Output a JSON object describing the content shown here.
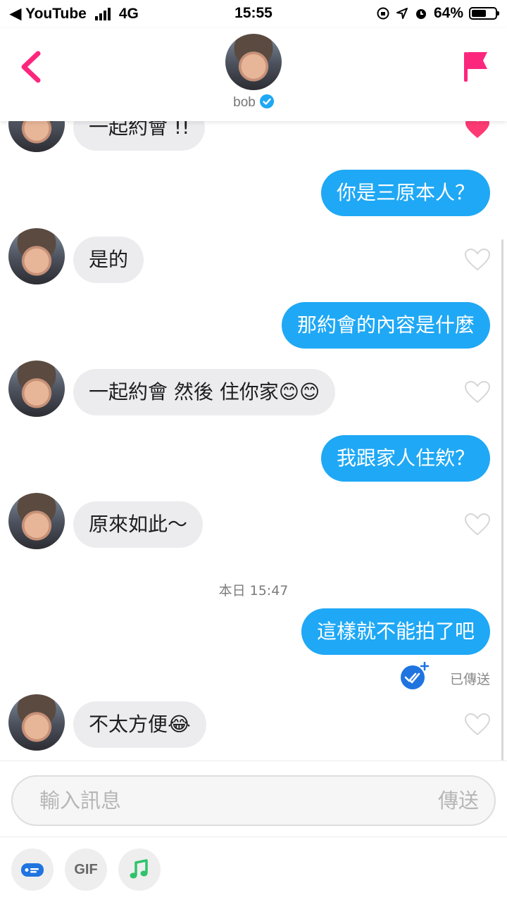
{
  "status_bar": {
    "back_app": "YouTube",
    "network": "4G",
    "time": "15:55",
    "battery": "64%",
    "battery_level": 0.64
  },
  "header": {
    "contact_name": "bob"
  },
  "messages": [
    {
      "side": "in",
      "text": "一起約會 !!"
    },
    {
      "side": "out",
      "text": "你是三原本人？"
    },
    {
      "side": "in",
      "text": "是的"
    },
    {
      "side": "out",
      "text": "那約會的內容是什麼"
    },
    {
      "side": "in",
      "text": "一起約會 然後 住你家😊😊"
    },
    {
      "side": "out",
      "text": "我跟家人住欸？"
    },
    {
      "side": "in",
      "text": "原來如此～"
    },
    {
      "side": "out",
      "text": "這樣就不能拍了吧"
    },
    {
      "side": "in",
      "text": "不太方便😂"
    }
  ],
  "timestamp": "本日 15:47",
  "sent_label": "已傳送",
  "input": {
    "placeholder": "輸入訊息",
    "send_label": "傳送"
  },
  "toolbar": {
    "gif_label": "GIF"
  },
  "colors": {
    "accent": "#fd267d",
    "bubble_out": "#1fa8f5",
    "bubble_in": "#ececef"
  },
  "icons": [
    "back-chevron-icon",
    "report-flag-icon",
    "verified-badge-icon",
    "heart-icon",
    "sent-check-icon",
    "sticker-icon",
    "music-note-icon"
  ]
}
